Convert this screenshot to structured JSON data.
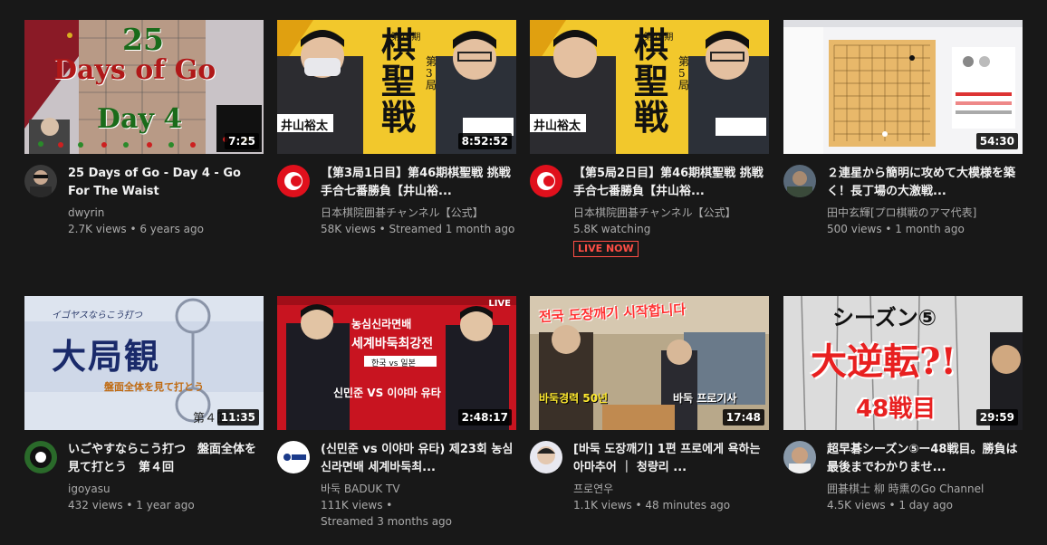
{
  "videos": [
    {
      "title": "25 Days of Go - Day 4 - Go For The Waist",
      "channel": "dwyrin",
      "stats": "2.7K views • 6 years ago",
      "duration": "7:25",
      "thumb_text": [
        "25",
        "Days of Go",
        "Day 4"
      ]
    },
    {
      "title": "【第3局1日目】第46期棋聖戦 挑戦手合七番勝負【井山裕...",
      "channel": "日本棋院囲碁チャンネル【公式】",
      "stats": "58K views • Streamed 1 month ago",
      "duration": "8:52:52",
      "thumb_text": [
        "棋聖戦",
        "井山裕太",
        "第3局"
      ]
    },
    {
      "title": "【第5局2日目】第46期棋聖戦 挑戦手合七番勝負【井山裕...",
      "channel": "日本棋院囲碁チャンネル【公式】",
      "stats": "5.8K watching",
      "live": "LIVE NOW",
      "thumb_text": [
        "棋聖戦",
        "井山裕太",
        "第5局"
      ]
    },
    {
      "title": "２連星から簡明に攻めて大模様を築く！長丁場の大激戦...",
      "channel": "田中玄輝[プロ棋戦のアマ代表]",
      "stats": "500 views • 1 month ago",
      "duration": "54:30"
    },
    {
      "title": "いごやすならこう打つ　盤面全体を見て打とう　第４回",
      "channel": "igoyasu",
      "stats": "432 views • 1 year ago",
      "duration": "11:35",
      "thumb_text": [
        "イゴヤスならこう打つ",
        "大局観",
        "盤面全体を見て打とう",
        "第４回"
      ]
    },
    {
      "title": "(신민준 vs 이야마 유타) 제23회 농심신라면배 세계바둑최...",
      "channel": "바둑 BADUK TV",
      "stats": "111K views •",
      "stats2": "Streamed 3 months ago",
      "duration": "2:48:17",
      "thumb_text": [
        "농심신라면배",
        "세계바둑최강전",
        "신민준 VS 이야마 유타",
        "LIVE",
        "한국 vs 일본"
      ]
    },
    {
      "title": "[바둑 도장깨기] 1편 프로에게 욕하는 아마추어 ｜ 청량리 ...",
      "channel": "프로연우",
      "stats": "1.1K views • 48 minutes ago",
      "duration": "17:48",
      "thumb_text": [
        "전국 도장깨기 시작합니다",
        "바둑경력 50년",
        "바둑 프로기사"
      ]
    },
    {
      "title": "超早碁シーズン⑤ー48戦目。勝負は最後までわかりませ...",
      "channel": "囲碁棋士 柳 時熏のGo Channel",
      "stats": "4.5K views • 1 day ago",
      "duration": "29:59",
      "thumb_text": [
        "シーズン⑤",
        "大逆転?!",
        "48戦目"
      ]
    }
  ],
  "colors": {
    "background": "#181818",
    "live_red": "#ff4e45",
    "subtext": "#aaaaaa"
  }
}
